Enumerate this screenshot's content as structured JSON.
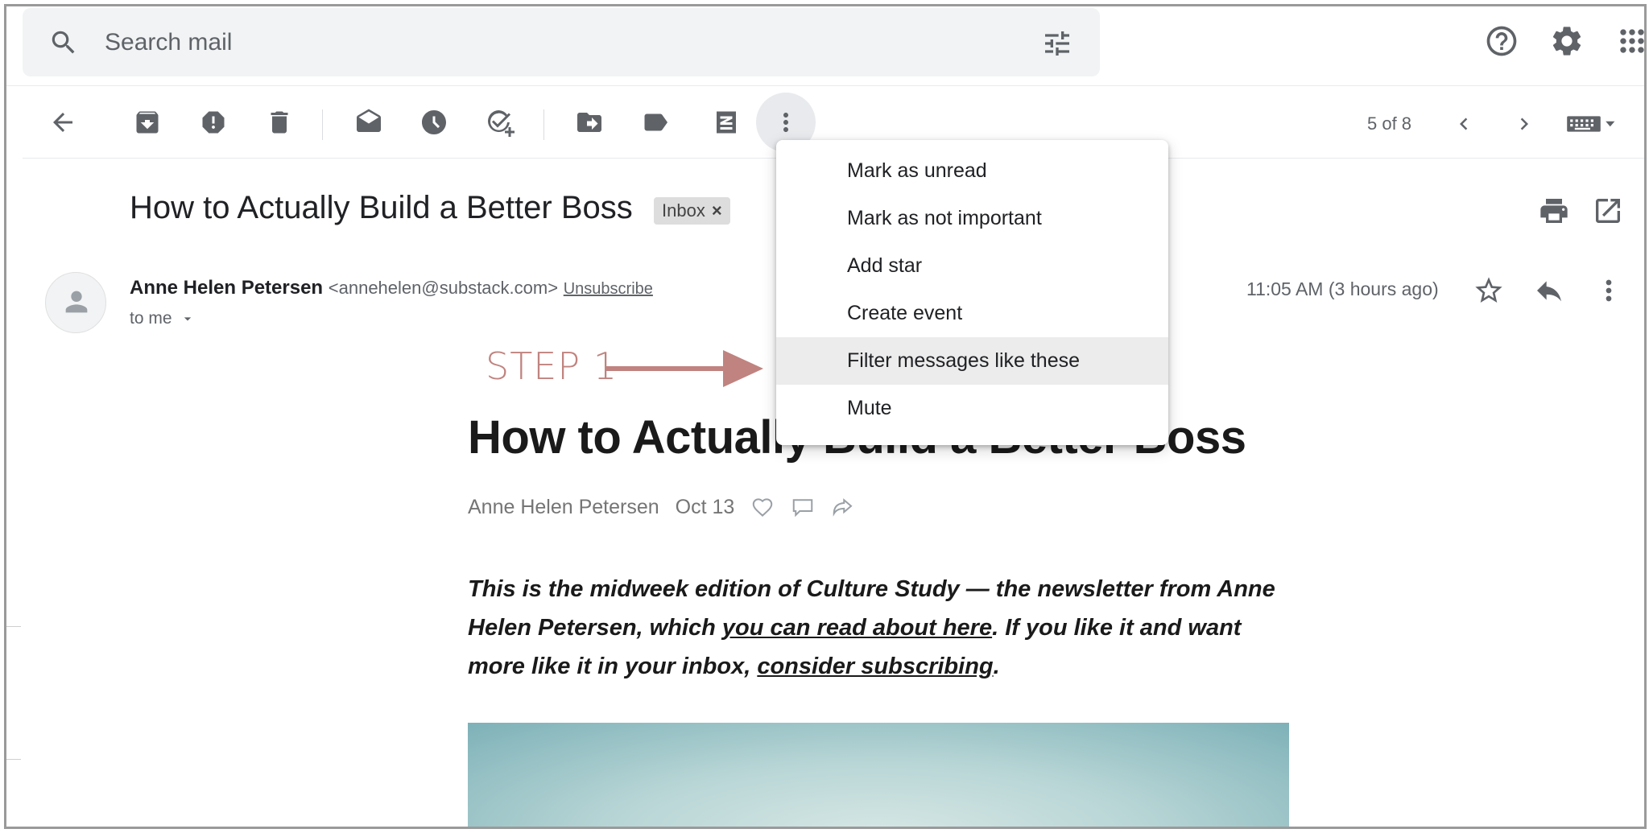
{
  "search": {
    "placeholder": "Search mail"
  },
  "toolbar": {
    "pager": "5 of 8"
  },
  "email": {
    "subject": "How to Actually Build a Better Boss",
    "label_chip": "Inbox",
    "sender_name": "Anne Helen Petersen",
    "sender_email": "<annehelen@substack.com>",
    "unsubscribe": "Unsubscribe",
    "to": "to me",
    "timestamp": "11:05 AM (3 hours ago)"
  },
  "more_menu": {
    "items": [
      "Mark as unread",
      "Mark as not important",
      "Add star",
      "Create event",
      "Filter messages like these",
      "Mute"
    ],
    "highlighted_index": 4
  },
  "annotation": {
    "step": "STEP 1",
    "color": "#c0837f"
  },
  "newsletter": {
    "title": "How to Actually Build a Better Boss",
    "author": "Anne Helen Petersen",
    "date": "Oct 13",
    "intro_1": "This is the midweek edition of Culture Study — the newsletter from Anne Helen Petersen, which ",
    "intro_link_1": "you can read about here",
    "intro_2": ". If you like it and want more like it in your inbox, ",
    "intro_link_2": "consider subscribing",
    "intro_3": "."
  }
}
